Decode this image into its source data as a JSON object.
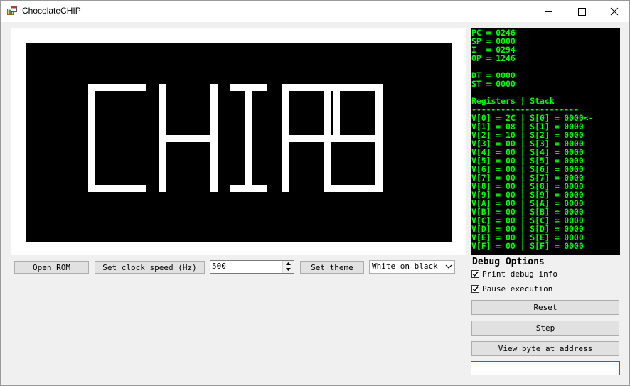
{
  "window": {
    "title": "ChocolateCHIP",
    "title_icon": "app-icon",
    "controls": [
      "minimize-icon",
      "maximize-icon",
      "close-icon"
    ]
  },
  "display": {
    "logo_text": "CHIP8",
    "background": "#000000",
    "foreground": "#ffffff"
  },
  "debug_registers": {
    "cpu": [
      "PC = 0246",
      "SP = 0000",
      "I  = 0294",
      "OP = 1246",
      "",
      "DT = 0000",
      "ST = 0000",
      ""
    ],
    "header": "Registers | Stack",
    "separator": "----------------------",
    "rows": [
      "V[0] = 2C | S[0] = 0000<-",
      "V[1] = 08 | S[1] = 0000",
      "V[2] = 10 | S[2] = 0000",
      "V[3] = 00 | S[3] = 0000",
      "V[4] = 00 | S[4] = 0000",
      "V[5] = 00 | S[5] = 0000",
      "V[6] = 00 | S[6] = 0000",
      "V[7] = 00 | S[7] = 0000",
      "V[8] = 00 | S[8] = 0000",
      "V[9] = 00 | S[9] = 0000",
      "V[A] = 00 | S[A] = 0000",
      "V[B] = 00 | S[B] = 0000",
      "V[C] = 00 | S[C] = 0000",
      "V[D] = 00 | S[D] = 0000",
      "V[E] = 00 | S[E] = 0000",
      "V[F] = 00 | S[F] = 0000"
    ],
    "text_color": "#00ff00"
  },
  "toolbar": {
    "open_rom": "Open ROM",
    "set_clock": "Set clock speed (Hz)",
    "clock_value": "500",
    "set_theme": "Set theme",
    "theme_value": "White on black"
  },
  "debug_options": {
    "title": "Debug Options",
    "print_debug": {
      "label": "Print debug info",
      "checked": true
    },
    "pause_exec": {
      "label": "Pause execution",
      "checked": true
    },
    "reset": "Reset",
    "step": "Step",
    "view_byte": "View byte at address",
    "address_value": ""
  }
}
